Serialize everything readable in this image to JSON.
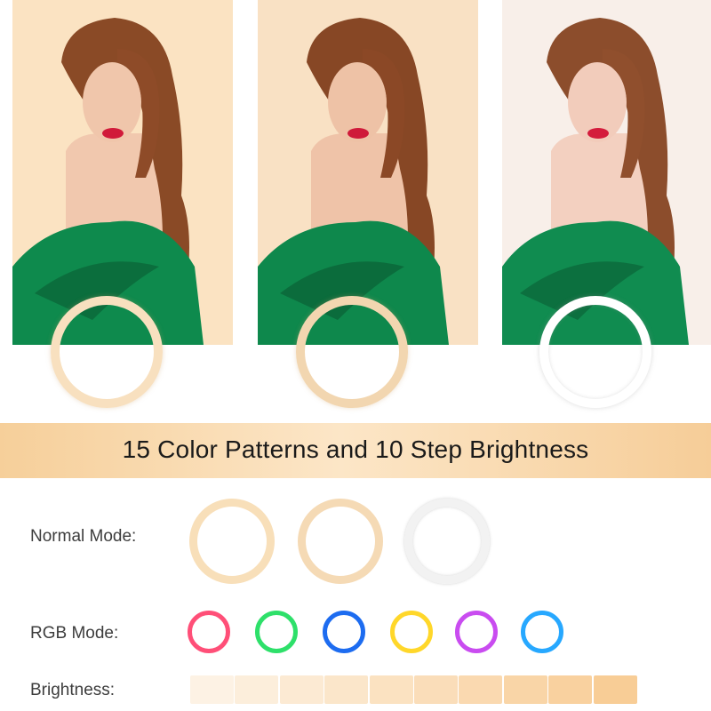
{
  "banner": {
    "title": "15 Color Patterns and 10 Step Brightness"
  },
  "photos": [
    {
      "name": "warm-light-photo",
      "tint": "#fbe4c4",
      "ring_color": "#f8e2c3"
    },
    {
      "name": "neutral-light-photo",
      "tint": "#f9e2c6",
      "ring_color": "#f3d9b4"
    },
    {
      "name": "cool-light-photo",
      "tint": "#f7eee8",
      "ring_color": "#ffffff"
    }
  ],
  "modes": {
    "normal_label": "Normal Mode:",
    "normal_colors": [
      "#f8dfb9",
      "#f5dab5",
      "#eeeeee"
    ],
    "rgb_label": "RGB Mode:",
    "rgb_colors": [
      "#ff4f78",
      "#2ee06a",
      "#1d6cf0",
      "#ffd72a",
      "#c94cf0",
      "#27a8ff"
    ],
    "brightness_label": "Brightness:",
    "brightness_levels": 10
  }
}
